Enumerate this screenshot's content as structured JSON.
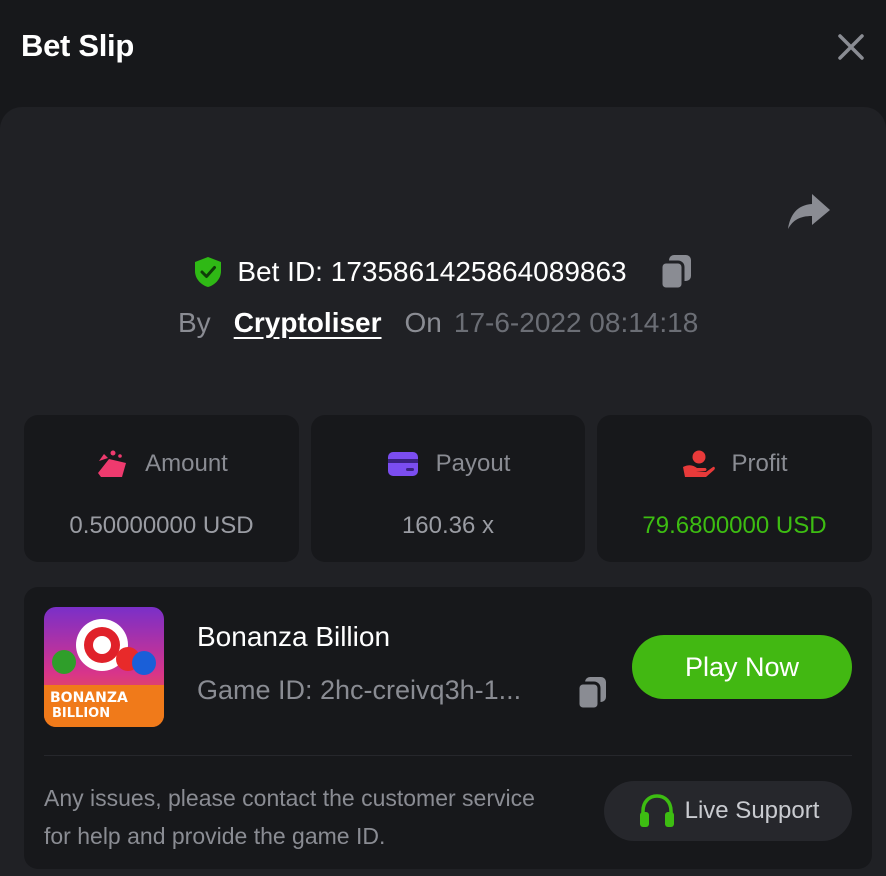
{
  "header": {
    "title": "Bet Slip"
  },
  "bet": {
    "id_label": "Bet ID: 17358614258640898​63",
    "by_label": "By",
    "username": "Cryptoliser",
    "on_label": "On",
    "datetime": "17-6-2022 08:14:18"
  },
  "stats": [
    {
      "label": "Amount",
      "value": "0.50000000 USD",
      "icon": "coins-icon"
    },
    {
      "label": "Payout",
      "value": "160.36 x",
      "icon": "card-icon"
    },
    {
      "label": "Profit",
      "value": "79.6800000 USD",
      "icon": "hand-money-icon"
    }
  ],
  "game": {
    "name": "Bonanza Billion",
    "id_text": "Game ID: 2hc-creivq3h-1...",
    "thumb_line1": "BONANZA",
    "thumb_line2": "BILLION",
    "play_label": "Play Now"
  },
  "help": {
    "text": "Any issues, please contact the customer service for help and provide the game ID.",
    "support_label": "Live Support"
  },
  "colors": {
    "background": "#17181b",
    "panel": "#202125",
    "accent_green": "#42b812",
    "profit_green": "#3dbd12",
    "amount_pink": "#ee3a6e",
    "payout_purple": "#7b4df0",
    "profit_red": "#e83a3a"
  }
}
